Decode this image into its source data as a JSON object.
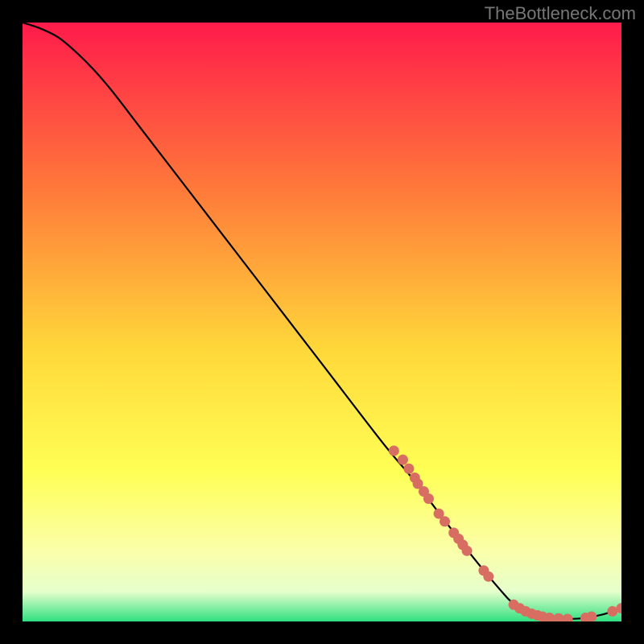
{
  "attribution": "TheBottleneck.com",
  "colors": {
    "gradient_top": "#ff1b4b",
    "gradient_mid1": "#ff7a3a",
    "gradient_mid2": "#ffd93a",
    "gradient_mid3": "#ffff55",
    "gradient_mid4": "#fbffa8",
    "gradient_mid5": "#e6ffcc",
    "gradient_bottom": "#30e080",
    "curve": "#000000",
    "marker_fill": "#d86d62",
    "marker_stroke": "#d86d62"
  },
  "chart_data": {
    "type": "line",
    "title": "",
    "xlabel": "",
    "ylabel": "",
    "xlim": [
      0,
      100
    ],
    "ylim": [
      0,
      100
    ],
    "series": [
      {
        "name": "bottleneck-curve",
        "x": [
          0,
          3,
          6,
          9,
          12,
          15,
          20,
          30,
          40,
          50,
          60,
          65,
          70,
          75,
          80,
          82,
          85,
          88,
          91,
          94,
          97,
          100
        ],
        "y": [
          100,
          99,
          97.5,
          95,
          92,
          88.5,
          82,
          69,
          56,
          43,
          30,
          24,
          17.5,
          11,
          5,
          3,
          1.2,
          0.6,
          0.4,
          0.6,
          1.2,
          2.2
        ]
      }
    ],
    "markers": {
      "name": "highlight-points",
      "x": [
        62,
        63.5,
        64.5,
        65.5,
        66,
        67,
        67.8,
        69.5,
        70.5,
        72,
        72.8,
        73.5,
        74.2,
        77,
        77.8,
        82,
        83,
        84,
        85,
        86,
        86.8,
        88,
        89.5,
        91,
        94,
        95,
        98.5,
        100
      ],
      "y": [
        28.5,
        27,
        25.5,
        24,
        23,
        21.7,
        20.5,
        18,
        16.7,
        14.8,
        13.8,
        12.8,
        11.8,
        8.5,
        7.5,
        2.8,
        2.2,
        1.7,
        1.3,
        1.0,
        0.8,
        0.6,
        0.5,
        0.4,
        0.6,
        0.8,
        1.7,
        2.2
      ]
    }
  }
}
